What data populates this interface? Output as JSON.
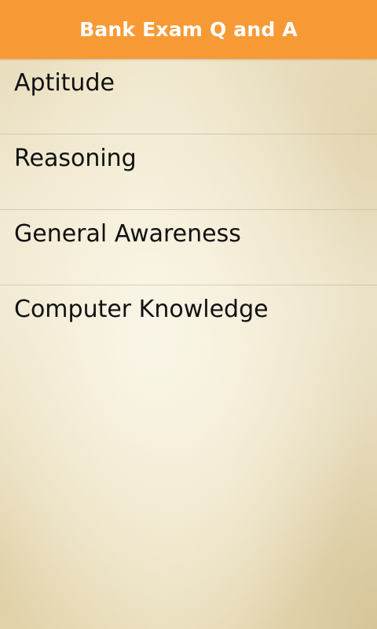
{
  "action_bar": {
    "title": "Bank Exam Q and A",
    "background_color": "#f79a36",
    "title_color": "#ffffff"
  },
  "menu": {
    "items": [
      {
        "label": "Aptitude"
      },
      {
        "label": "Reasoning"
      },
      {
        "label": "General Awareness"
      },
      {
        "label": "Computer Knowledge"
      }
    ]
  }
}
